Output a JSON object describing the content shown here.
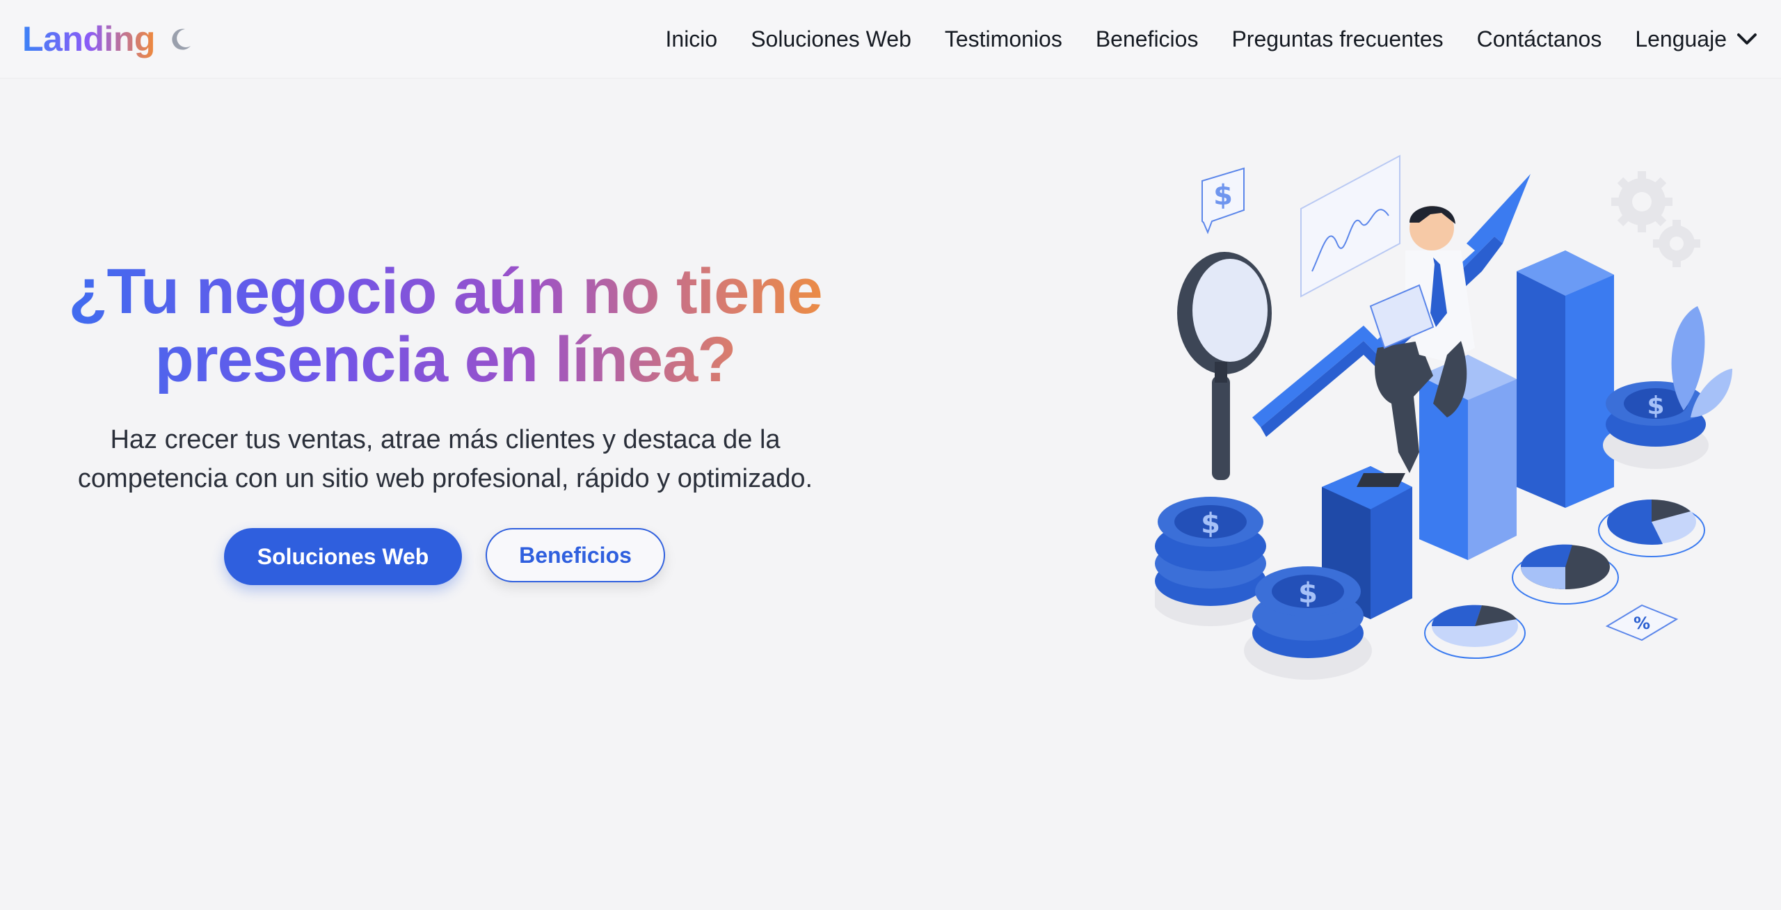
{
  "navbar": {
    "brand": "Landing",
    "theme_toggle_icon": "moon-icon",
    "links": [
      {
        "label": "Inicio"
      },
      {
        "label": "Soluciones Web"
      },
      {
        "label": "Testimonios"
      },
      {
        "label": "Beneficios"
      },
      {
        "label": "Preguntas frecuentes"
      },
      {
        "label": "Contáctanos"
      }
    ],
    "language": {
      "label": "Lenguaje",
      "icon": "chevron-down-icon"
    }
  },
  "hero": {
    "title_line1": "¿Tu negocio aún no tiene",
    "title_line2": "presencia en línea?",
    "subtitle_line1": "Haz crecer tus ventas, atrae más clientes y destaca de la",
    "subtitle_line2": "competencia con un sitio web profesional, rápido y optimizado.",
    "primary_button": "Soluciones Web",
    "secondary_button": "Beneficios",
    "illustration_icon": "business-growth-illustration",
    "illustration_badge": "%"
  },
  "colors": {
    "accent": "#2f5fde",
    "background": "#f4f4f6",
    "gradient_start": "#3b82f6",
    "gradient_mid": "#8b5cf6",
    "gradient_end": "#f08a3a"
  }
}
